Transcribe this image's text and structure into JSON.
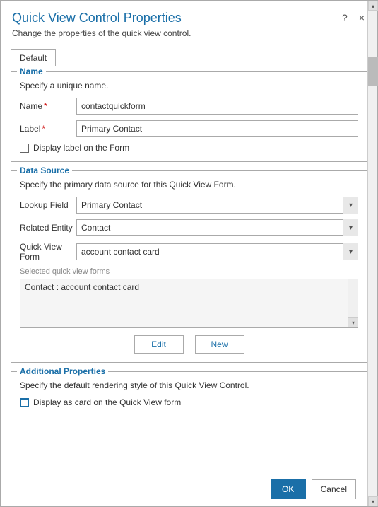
{
  "dialog": {
    "title": "Quick View Control Properties",
    "subtitle": "Change the properties of the quick view control.",
    "help_label": "?",
    "close_label": "×"
  },
  "tabs": [
    {
      "label": "Default"
    }
  ],
  "name_section": {
    "legend": "Name",
    "description": "Specify a unique name.",
    "name_label": "Name",
    "name_value": "contactquickform",
    "name_placeholder": "",
    "label_label": "Label",
    "label_value": "Primary Contact",
    "label_placeholder": "",
    "checkbox_label": "Display label on the Form"
  },
  "data_source_section": {
    "legend": "Data Source",
    "description": "Specify the primary data source for this Quick View Form.",
    "lookup_field_label": "Lookup Field",
    "lookup_field_value": "Primary Contact",
    "lookup_field_options": [
      "Primary Contact"
    ],
    "related_entity_label": "Related Entity",
    "related_entity_value": "Contact",
    "related_entity_options": [
      "Contact"
    ],
    "quick_view_form_label": "Quick View Form",
    "quick_view_form_value": "account contact card",
    "quick_view_form_options": [
      "account contact card"
    ],
    "selected_forms_label": "Selected quick view forms",
    "selected_forms_value": "Contact : account contact card",
    "edit_button": "Edit",
    "new_button": "New"
  },
  "additional_section": {
    "legend": "Additional Properties",
    "description": "Specify the default rendering style of this Quick View Control.",
    "checkbox_label": "Display as card on the Quick View form"
  },
  "footer": {
    "ok_label": "OK",
    "cancel_label": "Cancel"
  }
}
